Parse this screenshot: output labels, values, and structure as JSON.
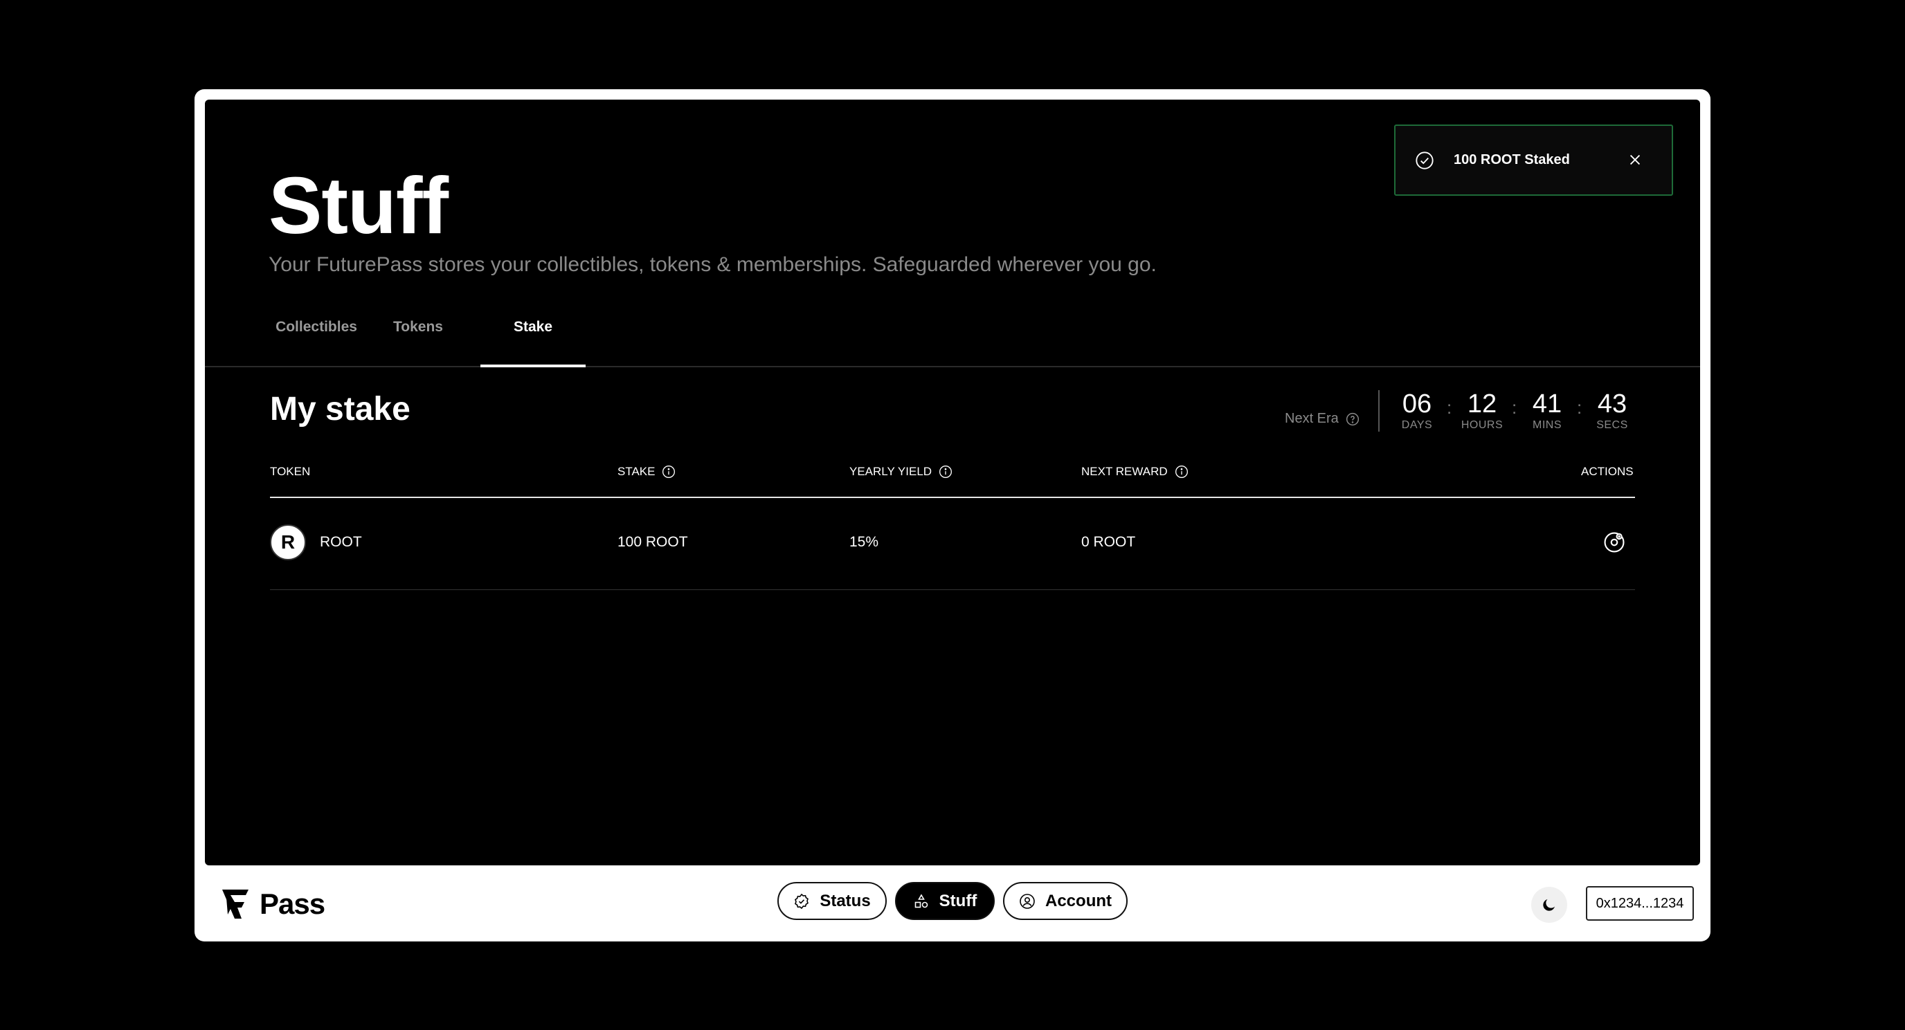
{
  "page": {
    "title": "Stuff",
    "subtitle": "Your FuturePass stores your collectibles, tokens & memberships. Safeguarded wherever you go."
  },
  "tabs": [
    {
      "label": "Collectibles",
      "active": false
    },
    {
      "label": "Tokens",
      "active": false
    },
    {
      "label": "Stake",
      "active": true
    }
  ],
  "toast": {
    "message": "100 ROOT Staked",
    "icon": "check-circle-icon",
    "border_color": "#1e6b38"
  },
  "stake": {
    "section_title": "My stake",
    "next_era": {
      "label": "Next Era",
      "days": "06",
      "days_label": "DAYS",
      "hours": "12",
      "hours_label": "HOURS",
      "mins": "41",
      "mins_label": "MINS",
      "secs": "43",
      "secs_label": "SECS"
    },
    "columns": {
      "token": "TOKEN",
      "stake": "STAKE",
      "yearly_yield": "YEARLY YIELD",
      "next_reward": "NEXT REWARD",
      "actions": "ACTIONS"
    },
    "rows": [
      {
        "token": "ROOT",
        "logo_letter": "R",
        "stake": "100 ROOT",
        "yearly_yield": "15%",
        "next_reward": "0 ROOT"
      }
    ]
  },
  "bottom_bar": {
    "logo_text": "Pass",
    "nav": [
      {
        "label": "Status",
        "icon": "badge-check-icon",
        "active": false
      },
      {
        "label": "Stuff",
        "icon": "shapes-icon",
        "active": true
      },
      {
        "label": "Account",
        "icon": "user-circle-icon",
        "active": false
      }
    ],
    "theme_icon": "moon-icon",
    "wallet_address": "0x1234...1234"
  }
}
